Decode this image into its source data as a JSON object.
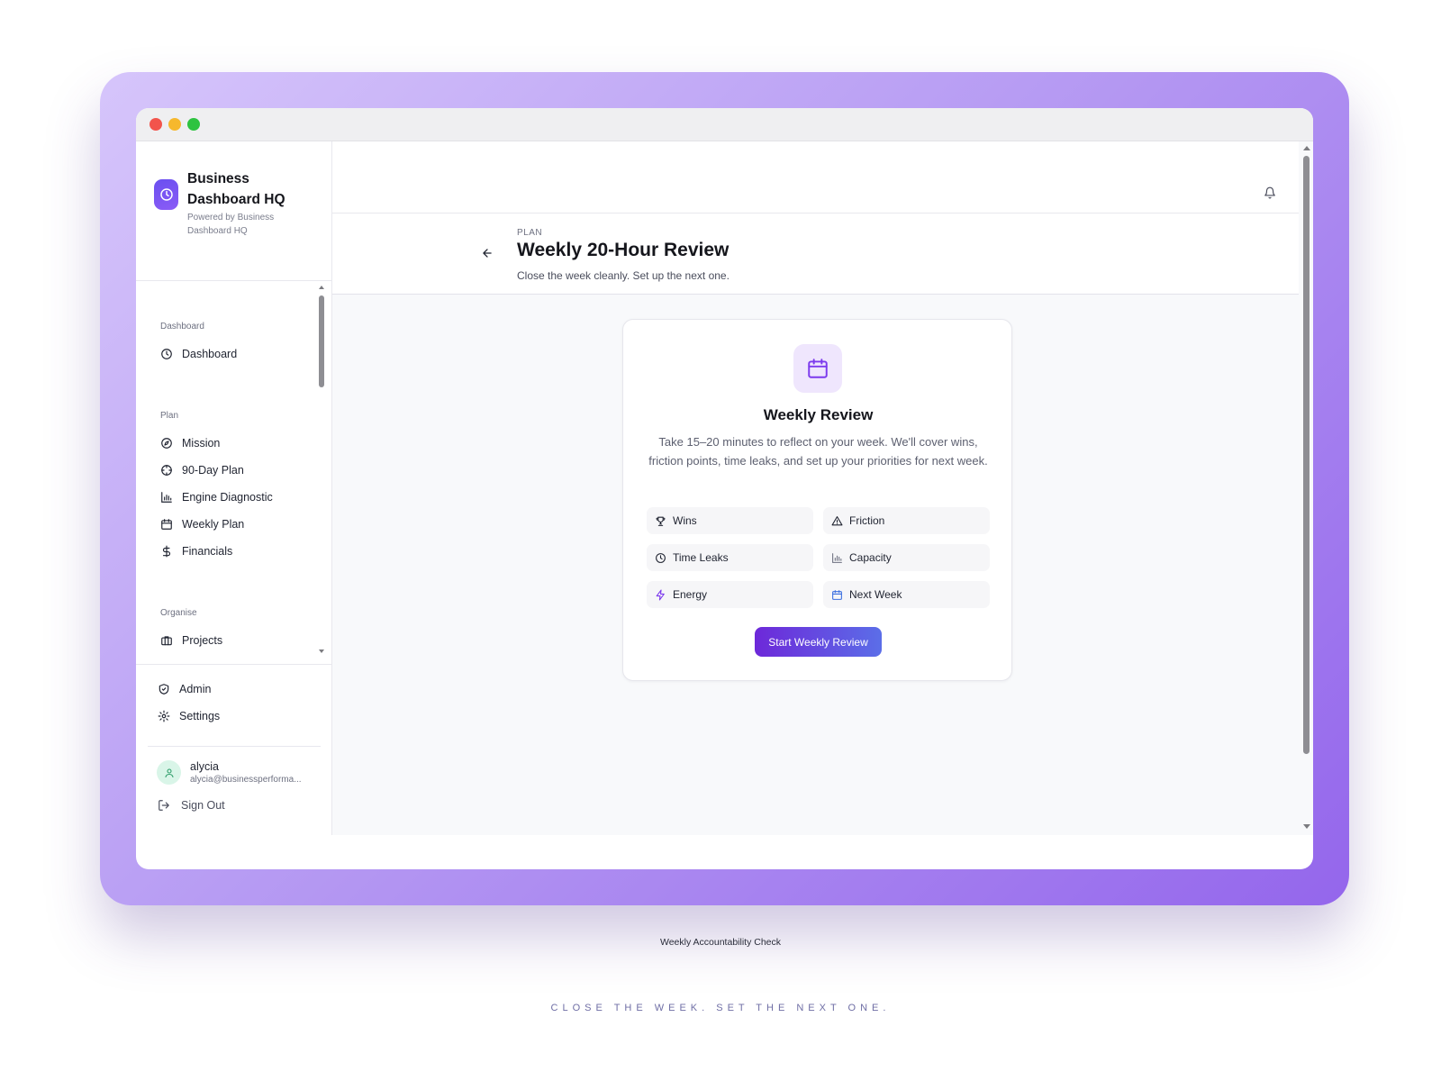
{
  "brand": {
    "name_line1": "Business",
    "name_line2": "Dashboard HQ",
    "sub_line1": "Powered by Business",
    "sub_line2": "Dashboard HQ"
  },
  "sidebar": {
    "sections": {
      "dashboard": "Dashboard",
      "plan": "Plan",
      "organise": "Organise"
    },
    "items": {
      "dashboard": "Dashboard",
      "mission": "Mission",
      "plan90": "90-Day Plan",
      "engine": "Engine Diagnostic",
      "weekly": "Weekly Plan",
      "financials": "Financials",
      "projects": "Projects"
    },
    "footer": {
      "admin": "Admin",
      "settings": "Settings",
      "signout": "Sign Out"
    },
    "user": {
      "name": "alycia",
      "email": "alycia@businessperforma..."
    }
  },
  "page": {
    "crumb": "PLAN",
    "title": "Weekly 20-Hour Review",
    "subtitle": "Close the week cleanly. Set up the next one."
  },
  "card": {
    "title": "Weekly Review",
    "description": "Take 15–20 minutes to reflect on your week. We'll cover wins, friction points, time leaks, and set up your priorities for next week.",
    "chips": {
      "wins": "Wins",
      "friction": "Friction",
      "timeleaks": "Time Leaks",
      "capacity": "Capacity",
      "energy": "Energy",
      "nextweek": "Next Week"
    },
    "cta": "Start Weekly Review"
  },
  "caption": "Weekly Accountability Check",
  "tagline": "CLOSE THE WEEK. SET THE NEXT ONE.",
  "colors": {
    "accent": "#6d28d9",
    "accent_end": "#5b6ee8",
    "frame_start": "#d6c5fb",
    "frame_end": "#9466ec"
  },
  "icons": {
    "brand": "clock-icon",
    "notifications": "bell-icon",
    "back": "arrow-left-icon",
    "card": "calendar-icon"
  }
}
